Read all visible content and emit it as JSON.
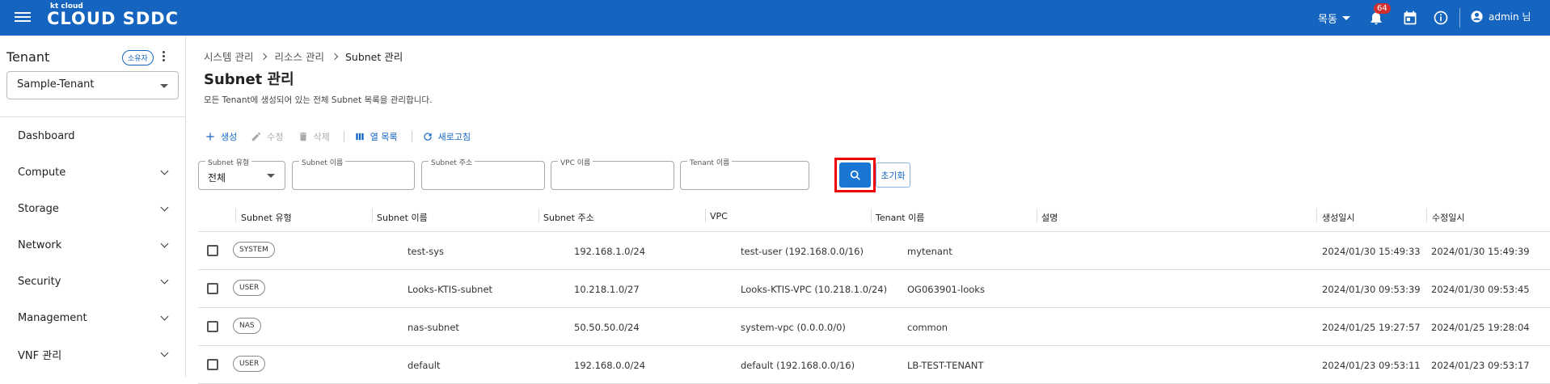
{
  "header": {
    "logo_small": "kt cloud",
    "logo_big": "CLOUD SDDC",
    "region": "목동",
    "notification_count": "64",
    "user": "admin 님",
    "brand_color": "#1565c0"
  },
  "sidebar": {
    "tenant_title": "Tenant",
    "owner_chip": "소유자",
    "tenant_selected": "Sample-Tenant",
    "items": [
      {
        "label": "Dashboard",
        "expandable": false
      },
      {
        "label": "Compute",
        "expandable": true
      },
      {
        "label": "Storage",
        "expandable": true
      },
      {
        "label": "Network",
        "expandable": true
      },
      {
        "label": "Security",
        "expandable": true
      },
      {
        "label": "Management",
        "expandable": true
      },
      {
        "label": "VNF 관리",
        "expandable": true
      }
    ]
  },
  "breadcrumb": [
    "시스템 관리",
    "리소스 관리",
    "Subnet 관리"
  ],
  "page": {
    "title": "Subnet 관리",
    "description": "모든 Tenant에 생성되어 있는 전체 Subnet 목록을 관리합니다."
  },
  "toolbar": {
    "create": "생성",
    "edit": "수정",
    "delete": "삭제",
    "columns": "열 목록",
    "refresh": "새로고침"
  },
  "filters": {
    "subnet_type_label": "Subnet 유형",
    "subnet_type_value": "전체",
    "subnet_name_label": "Subnet 이름",
    "subnet_address_label": "Subnet 주소",
    "vpc_name_label": "VPC 이름",
    "tenant_name_label": "Tenant 이름",
    "reset": "초기화"
  },
  "table": {
    "headers": [
      "Subnet 유형",
      "Subnet 이름",
      "Subnet 주소",
      "VPC",
      "Tenant 이름",
      "설명",
      "생성일시",
      "수정일시"
    ],
    "rows": [
      {
        "type": "SYSTEM",
        "name": "test-sys",
        "address": "192.168.1.0/24",
        "vpc": "test-user (192.168.0.0/16)",
        "tenant": "mytenant",
        "desc": "",
        "created": "2024/01/30 15:49:33",
        "updated": "2024/01/30 15:49:39"
      },
      {
        "type": "USER",
        "name": "Looks-KTIS-subnet",
        "address": "10.218.1.0/27",
        "vpc": "Looks-KTIS-VPC (10.218.1.0/24)",
        "tenant": "OG063901-looks",
        "desc": "",
        "created": "2024/01/30 09:53:39",
        "updated": "2024/01/30 09:53:45"
      },
      {
        "type": "NAS",
        "name": "nas-subnet",
        "address": "50.50.50.0/24",
        "vpc": "system-vpc (0.0.0.0/0)",
        "tenant": "common",
        "desc": "",
        "created": "2024/01/25 19:27:57",
        "updated": "2024/01/25 19:28:04"
      },
      {
        "type": "USER",
        "name": "default",
        "address": "192.168.0.0/24",
        "vpc": "default (192.168.0.0/16)",
        "tenant": "LB-TEST-TENANT",
        "desc": "",
        "created": "2024/01/23 09:53:11",
        "updated": "2024/01/23 09:53:17"
      }
    ]
  }
}
